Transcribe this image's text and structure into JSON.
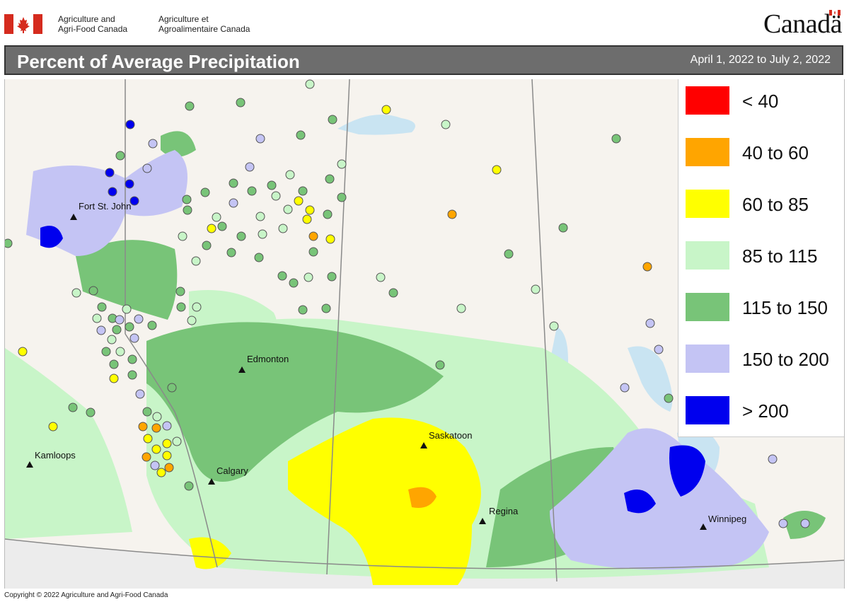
{
  "header": {
    "dept_en_line1": "Agriculture and",
    "dept_en_line2": "Agri-Food Canada",
    "dept_fr_line1": "Agriculture et",
    "dept_fr_line2": "Agroalimentaire Canada",
    "wordmark": "Canadä"
  },
  "title": "Percent of Average Precipitation",
  "date_range": "April 1, 2022 to July 2, 2022",
  "legend": [
    {
      "label": "< 40",
      "color": "#ff0000"
    },
    {
      "label": "40 to 60",
      "color": "#ffa500"
    },
    {
      "label": "60 to 85",
      "color": "#ffff00"
    },
    {
      "label": "85 to 115",
      "color": "#c8f5c8"
    },
    {
      "label": "115 to 150",
      "color": "#78c478"
    },
    {
      "label": "150 to 200",
      "color": "#c4c4f4"
    },
    {
      "label": "> 200",
      "color": "#0000ee"
    }
  ],
  "cities": {
    "fort_st_john": "Fort St. John",
    "edmonton": "Edmonton",
    "kamloops": "Kamloops",
    "calgary": "Calgary",
    "saskatoon": "Saskatoon",
    "regina": "Regina",
    "winnipeg": "Winnipeg"
  },
  "copyright": "Copyright © 2022 Agriculture and Agri-Food Canada",
  "colors": {
    "flag_red": "#d52b1e",
    "titlebar": "#6d6d6d",
    "water": "#c9e4f2",
    "land": "#f6f3ee"
  }
}
